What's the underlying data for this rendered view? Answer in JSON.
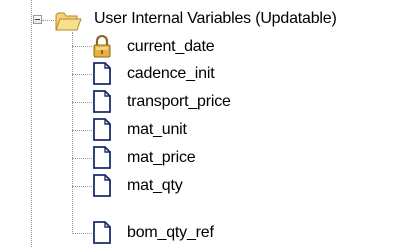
{
  "tree": {
    "root": {
      "label": "User Internal Variables (Updatable)",
      "icon": "folder-open-icon",
      "expanded": true
    },
    "items": [
      {
        "label": "current_date",
        "icon": "lock-icon"
      },
      {
        "label": "cadence_init",
        "icon": "document-icon"
      },
      {
        "label": "transport_price",
        "icon": "document-icon"
      },
      {
        "label": "mat_unit",
        "icon": "document-icon"
      },
      {
        "label": "mat_price",
        "icon": "document-icon"
      },
      {
        "label": "mat_qty",
        "icon": "document-icon"
      },
      {
        "label": "bom_qty_ref",
        "icon": "document-icon"
      }
    ],
    "colors": {
      "folder": "#f0c860",
      "lock": "#e0a830",
      "document_outline": "#1a2d6e",
      "connector": "#9a9a9a"
    }
  }
}
